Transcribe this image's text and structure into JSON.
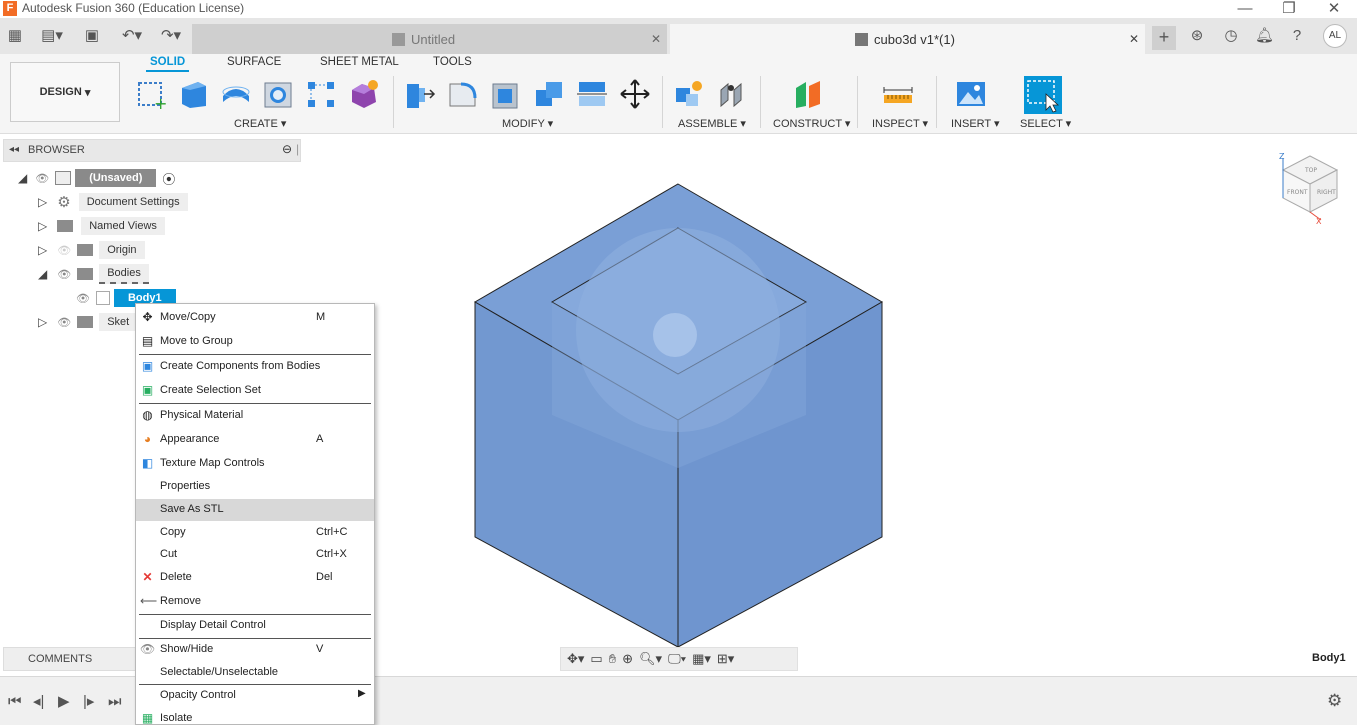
{
  "window": {
    "title": "Autodesk Fusion 360 (Education License)"
  },
  "tabs": [
    {
      "label": "Untitled",
      "active": false
    },
    {
      "label": "cubo3d v1*(1)",
      "active": true
    }
  ],
  "user_initials": "AL",
  "workspace": {
    "label": "DESIGN"
  },
  "ribbon": {
    "tabs": [
      "SOLID",
      "SURFACE",
      "SHEET METAL",
      "TOOLS"
    ],
    "groups": [
      "CREATE",
      "MODIFY",
      "ASSEMBLE",
      "CONSTRUCT",
      "INSPECT",
      "INSERT",
      "SELECT"
    ]
  },
  "browser": {
    "title": "BROWSER",
    "root": "(Unsaved)",
    "items": [
      "Document Settings",
      "Named Views",
      "Origin",
      "Bodies",
      "Body1",
      "Sket"
    ]
  },
  "context_menu": [
    {
      "label": "Move/Copy",
      "shortcut": "M"
    },
    {
      "label": "Move to Group",
      "shortcut": ""
    },
    {
      "label": "Create Components from Bodies",
      "shortcut": ""
    },
    {
      "label": "Create Selection Set",
      "shortcut": ""
    },
    {
      "label": "Physical Material",
      "shortcut": ""
    },
    {
      "label": "Appearance",
      "shortcut": "A"
    },
    {
      "label": "Texture Map Controls",
      "shortcut": ""
    },
    {
      "label": "Properties",
      "shortcut": ""
    },
    {
      "label": "Save As STL",
      "shortcut": "",
      "highlighted": true
    },
    {
      "label": "Copy",
      "shortcut": "Ctrl+C"
    },
    {
      "label": "Cut",
      "shortcut": "Ctrl+X"
    },
    {
      "label": "Delete",
      "shortcut": "Del"
    },
    {
      "label": "Remove",
      "shortcut": ""
    },
    {
      "label": "Display Detail Control",
      "shortcut": ""
    },
    {
      "label": "Show/Hide",
      "shortcut": "V"
    },
    {
      "label": "Selectable/Unselectable",
      "shortcut": ""
    },
    {
      "label": "Opacity Control",
      "shortcut": ""
    },
    {
      "label": "Isolate",
      "shortcut": ""
    }
  ],
  "comments": {
    "label": "COMMENTS"
  },
  "viewcube": {
    "top": "TOP",
    "front": "FRONT",
    "right": "RIGHT",
    "z": "Z",
    "x": "X"
  },
  "status": {
    "selection": "Body1"
  },
  "colors": {
    "accent": "#0696d7",
    "body": "#7a9fd6",
    "fusion_orange": "#f26c25"
  }
}
